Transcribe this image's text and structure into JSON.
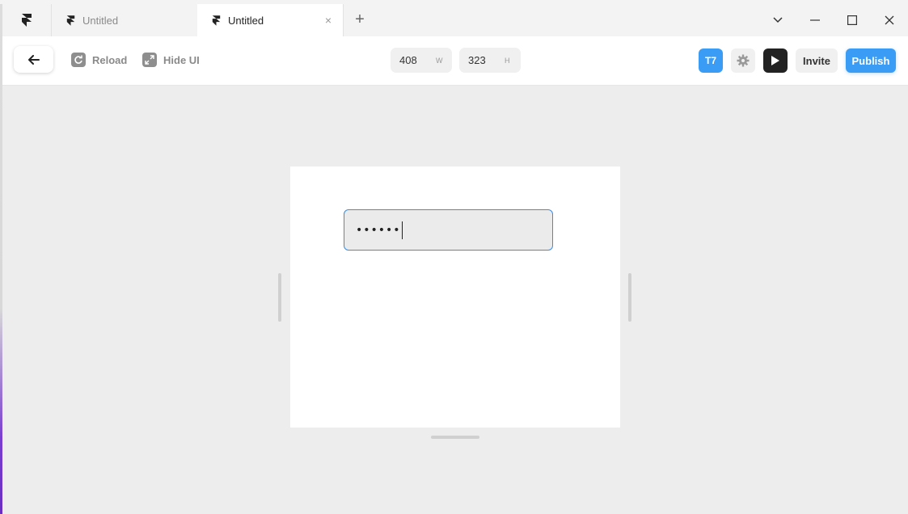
{
  "tabs": [
    {
      "label": "Untitled",
      "active": false
    },
    {
      "label": "Untitled",
      "active": true
    }
  ],
  "tab_close": "×",
  "new_tab": "+",
  "toolbar": {
    "reload_label": "Reload",
    "hide_ui_label": "Hide UI",
    "width_value": "408",
    "width_unit": "W",
    "height_value": "323",
    "height_unit": "H",
    "avatar_initials": "T7",
    "invite_label": "Invite",
    "publish_label": "Publish"
  },
  "canvas": {
    "password_mask": "••••••"
  },
  "colors": {
    "accent": "#3b9cf5",
    "canvas_bg": "#ededed",
    "input_border": "#3a8ee6"
  }
}
